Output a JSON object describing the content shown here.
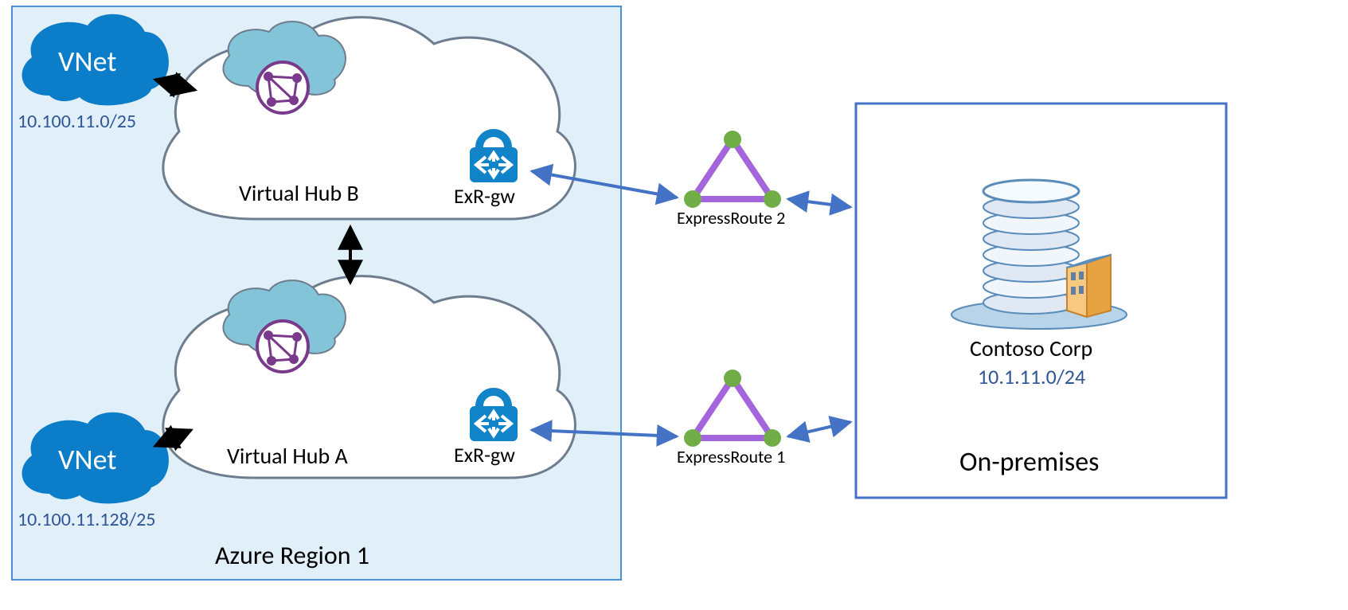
{
  "region": {
    "title": "Azure Region 1"
  },
  "vnet_top": {
    "label": "VNet",
    "cidr": "10.100.11.0/25"
  },
  "vnet_bottom": {
    "label": "VNet",
    "cidr": "10.100.11.128/25"
  },
  "hub_b": {
    "label": "Virtual Hub B",
    "gateway": "ExR-gw"
  },
  "hub_a": {
    "label": "Virtual Hub A",
    "gateway": "ExR-gw"
  },
  "er1": {
    "label": "ExpressRoute 1"
  },
  "er2": {
    "label": "ExpressRoute 2"
  },
  "onprem": {
    "title": "On-premises",
    "corp": "Contoso Corp",
    "cidr": "10.1.11.0/24"
  }
}
